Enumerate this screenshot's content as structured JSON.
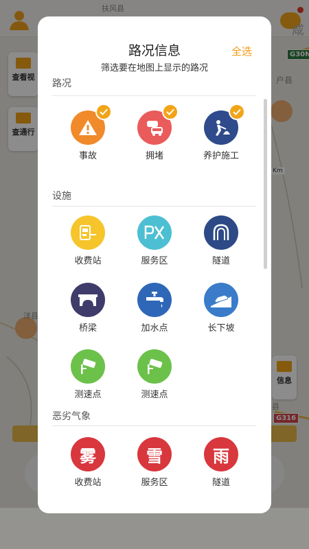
{
  "dialog": {
    "title": "路况信息",
    "select_all": "全选",
    "subtitle": "筛选要在地图上显示的路况"
  },
  "sections": [
    {
      "title": "路况",
      "items": [
        {
          "label": "事故",
          "icon": "accident-warning-icon",
          "color": "#f08a2a",
          "checked": true
        },
        {
          "label": "拥堵",
          "icon": "traffic-jam-icon",
          "color": "#ea5b5b",
          "checked": true
        },
        {
          "label": "养护施工",
          "icon": "road-construction-icon",
          "color": "#2f4b8c",
          "checked": true
        }
      ]
    },
    {
      "title": "设施",
      "items": [
        {
          "label": "收费站",
          "icon": "toll-station-icon",
          "color": "#f5c52b",
          "checked": false
        },
        {
          "label": "服务区",
          "icon": "service-area-icon",
          "color": "#4cbfd3",
          "checked": false
        },
        {
          "label": "隧道",
          "icon": "tunnel-icon",
          "color": "#2d4a86",
          "checked": false
        },
        {
          "label": "桥梁",
          "icon": "bridge-icon",
          "color": "#3f3b6b",
          "checked": false
        },
        {
          "label": "加水点",
          "icon": "water-tap-icon",
          "color": "#2f67b8",
          "checked": false
        },
        {
          "label": "长下坡",
          "icon": "downhill-slope-icon",
          "color": "#3a7cc9",
          "checked": false
        },
        {
          "label": "测速点",
          "icon": "speed-camera-icon",
          "color": "#6cc14a",
          "checked": false
        },
        {
          "label": "测速点",
          "icon": "speed-camera-icon",
          "color": "#6cc14a",
          "checked": false
        }
      ]
    },
    {
      "title": "恶劣气象",
      "items": [
        {
          "label": "收费站",
          "icon": "fog-icon",
          "glyph": "雾",
          "color": "#d8373d",
          "checked": false
        },
        {
          "label": "服务区",
          "icon": "snow-icon",
          "glyph": "雪",
          "color": "#d8373d",
          "checked": false
        },
        {
          "label": "隧道",
          "icon": "rain-icon",
          "glyph": "雨",
          "color": "#d8373d",
          "checked": false
        }
      ]
    }
  ],
  "background": {
    "map_labels": [
      "扶风县",
      "户县",
      "咸",
      "Km",
      "洋县",
      "县"
    ],
    "cards": [
      "查看视",
      "查通行",
      "信息"
    ],
    "badges": [
      "G30N",
      "G316"
    ]
  },
  "colors": {
    "accent": "#f39b15",
    "check": "#f2a419"
  }
}
